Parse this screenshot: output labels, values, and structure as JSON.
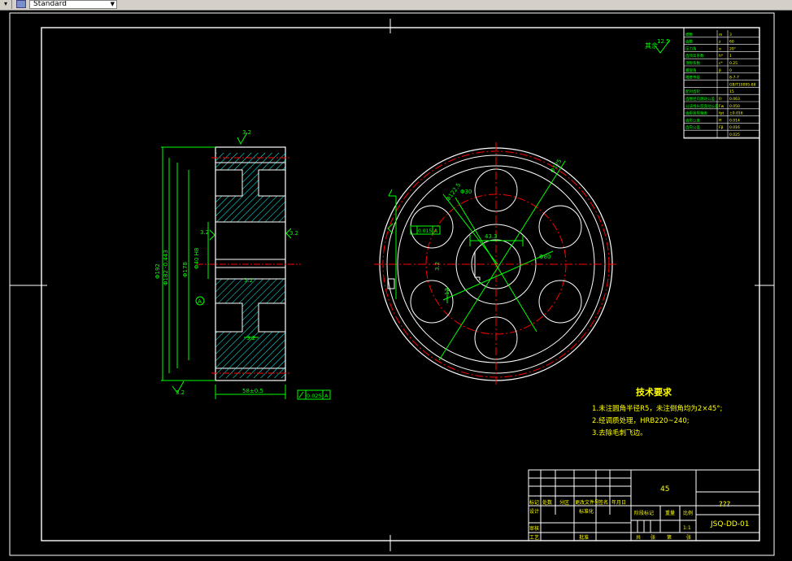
{
  "toolbar": {
    "style_select_value": "Standard",
    "arrow_glyph": "▾"
  },
  "drawing": {
    "tech_title": "技术要求",
    "tech_items": [
      "1.未注圆角半径R5，未注倒角均为2×45°;",
      "2.经调质处理，HRB220~240;",
      "3.去除毛刺飞边。"
    ],
    "surface_note": "其余",
    "surface_value": "12.5",
    "side_view": {
      "top_roughness": "3.2",
      "left_roughness": "3.2",
      "hub_roughness": "3.2",
      "right_roughness": "3.2",
      "bottom_roughness": "3.2",
      "center_roughness": "3.2",
      "dim_od": "Φ192",
      "dim_mid": "Φ182 -0.443",
      "dim_pitch": "Φ178",
      "dim_bore": "Φ40 H8",
      "dim_width": "58±0.5",
      "tolerance": "0.025",
      "datum": "A"
    },
    "front_view": {
      "keyway": "43.3",
      "dia_holes": "Φ30",
      "dia_circle": "Φ122.5",
      "dia_right": "Φ80",
      "pcd": "Φ125",
      "fcf_value": "0.015",
      "fcf_datum": "A",
      "key_tol": "12",
      "left_roughness": "3.2"
    },
    "param_table": {
      "rows": [
        [
          "模数",
          "m",
          "3"
        ],
        [
          "齿数",
          "z",
          "60"
        ],
        [
          "压力角",
          "α",
          "20°"
        ],
        [
          "齿顶高系数",
          "h*",
          "1"
        ],
        [
          "顶隙系数",
          "c*",
          "0.25"
        ],
        [
          "螺旋角",
          "β",
          "0"
        ],
        [
          "精度等级",
          "",
          "8-7-7"
        ],
        [
          "",
          "",
          "GB/T10095-88"
        ],
        [
          "配对齿轮",
          "",
          "15"
        ],
        [
          "齿圈径向跳动公差",
          "Fr",
          "0.063"
        ],
        [
          "公法线长度变动公差",
          "Fw",
          "0.050"
        ],
        [
          "齿距极限偏差",
          "fpt",
          "±0.016"
        ],
        [
          "齿形公差",
          "ff",
          "0.014"
        ],
        [
          "齿向公差",
          "Fβ",
          "0.016"
        ],
        [
          "",
          "",
          "0.025"
        ]
      ]
    },
    "title_block": {
      "material": "45",
      "part_name": "???",
      "drawing_no": "JSQ-DD-01",
      "scale": "1:1",
      "labels": {
        "mark": "标记",
        "count": "处数",
        "zone": "分区",
        "change_doc": "更改文件号",
        "sign": "签名",
        "date": "年月日",
        "designer": "设计",
        "standardize": "标准化",
        "stage_mark": "阶段标记",
        "weight": "重量",
        "scale_label": "比例",
        "review": "审核",
        "process": "工艺",
        "approve": "批准",
        "total": "共",
        "sheet": "张",
        "of": "第"
      }
    },
    "colors": {
      "frame": "#ffffff",
      "dimension": "#00ff00",
      "centerline": "#ff0000",
      "hatch": "#00ffff",
      "text": "#ffff00"
    }
  }
}
